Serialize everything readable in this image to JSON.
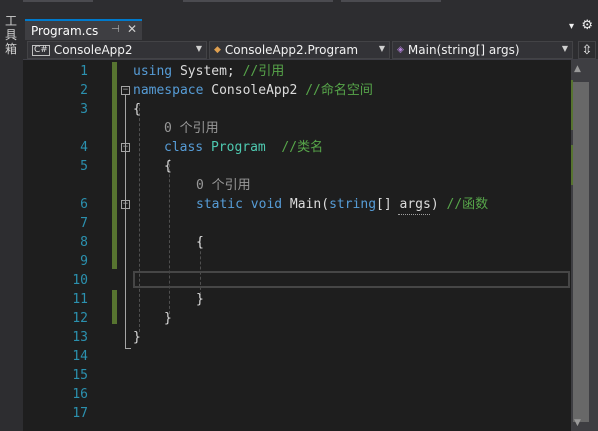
{
  "toolbox": {
    "label": "工具箱"
  },
  "tab": {
    "title": "Program.cs",
    "pin_glyph": "⊣",
    "close_glyph": "✕"
  },
  "tab_controls": {
    "menu_glyph": "▾",
    "settings_glyph": "⚙"
  },
  "nav": {
    "project": "ConsoleApp2",
    "type": "ConsoleApp2.Program",
    "member": "Main(string[] args)",
    "split_glyph": "⇳"
  },
  "editor": {
    "line_numbers": [
      "1",
      "2",
      "3",
      "4",
      "5",
      "6",
      "7",
      "8",
      "9",
      "10",
      "11",
      "12",
      "13",
      "14",
      "15",
      "16",
      "17"
    ],
    "code_lens": [
      "0 个引用",
      "0 个引用"
    ],
    "tokens": {
      "using": "using",
      "system": " System; ",
      "c_using": "//引用",
      "namespace": "namespace",
      "ns_name": " ConsoleApp2 ",
      "c_ns": "//命名空间",
      "brace_open": "{",
      "brace_close": "}",
      "class": "class",
      "class_name": " Program",
      "c_class": "  //类名",
      "static": "static",
      "void": " void",
      "main": " Main(",
      "string": "string",
      "arr": "[] ",
      "args": "args",
      "close_paren": ") ",
      "c_main": "//函数"
    }
  },
  "colors": {
    "accent": "#007acc",
    "keyword": "#569cd6",
    "type": "#4ec9b0",
    "comment": "#57a64a",
    "line_number": "#2b91af",
    "changed_bar": "#577430"
  }
}
